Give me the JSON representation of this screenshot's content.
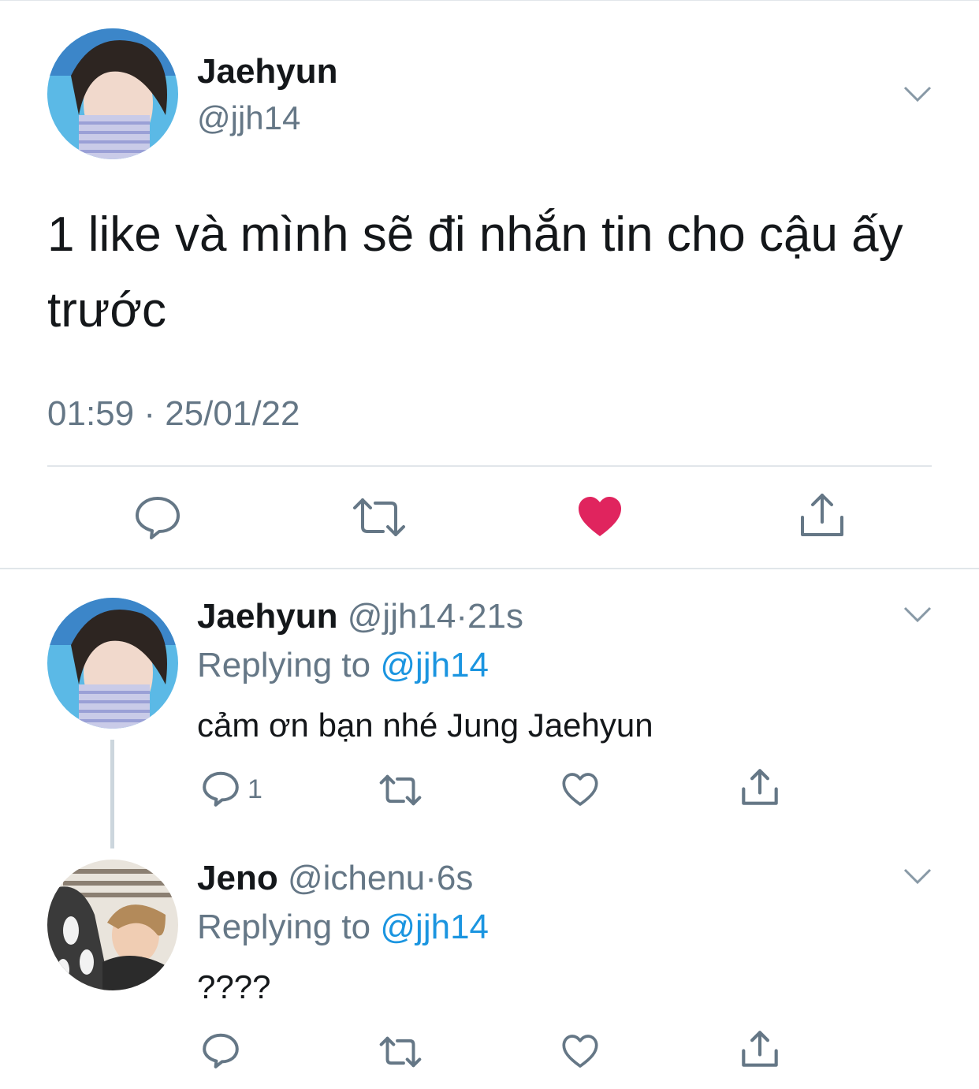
{
  "main_tweet": {
    "display_name": "Jaehyun",
    "handle": "@jjh14",
    "text_line1": "1 like và mình sẽ đi nhắn tin cho cậu ấy",
    "text_line2": "trước",
    "timestamp": "01:59 · 25/01/22",
    "liked": true,
    "actions": {
      "reply": "reply-icon",
      "retweet": "retweet-icon",
      "like": "heart-filled-icon",
      "share": "share-icon"
    }
  },
  "replies": [
    {
      "display_name": "Jaehyun",
      "handle": "@jjh14",
      "sep": "·",
      "time": "21s",
      "replying_label": "Replying to",
      "replying_handle": "@jjh14",
      "text": "cảm ơn bạn nhé Jung Jaehyun",
      "reply_count": "1"
    },
    {
      "display_name": "Jeno",
      "handle": "@ichenu",
      "sep": "·",
      "time": "6s",
      "replying_label": "Replying to",
      "replying_handle": "@jjh14",
      "text": "????",
      "reply_count": ""
    }
  ],
  "colors": {
    "text": "#14171a",
    "muted": "#657786",
    "link": "#1b95e0",
    "like": "#e0245e",
    "divider": "#e1e6ea",
    "thread_line": "#ccd6dd"
  }
}
